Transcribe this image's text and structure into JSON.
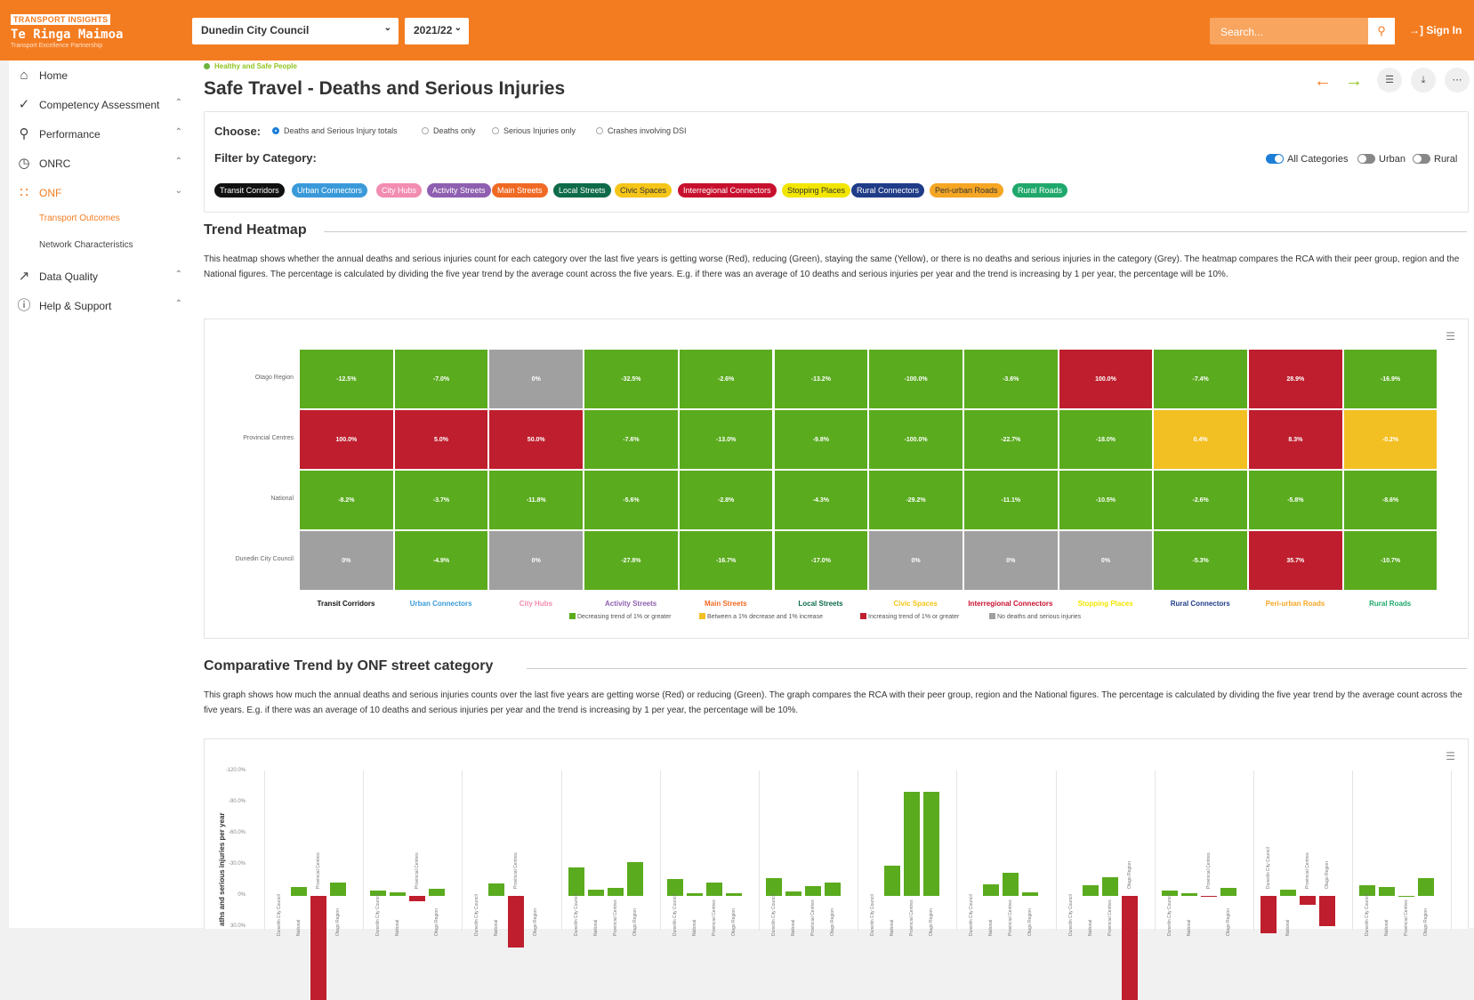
{
  "brand": {
    "tag": "TRANSPORT INSIGHTS",
    "name": "Te Ringa Maimoa",
    "sub": "Transport Excellence Partnership"
  },
  "header": {
    "council": "Dunedin City Council",
    "year": "2021/22",
    "search_placeholder": "Search...",
    "signin": "Sign In"
  },
  "sidebar": {
    "items": [
      {
        "label": "Home",
        "icon": "home-icon"
      },
      {
        "label": "Competency Assessment",
        "icon": "check-circle-icon"
      },
      {
        "label": "Performance",
        "icon": "award-icon"
      },
      {
        "label": "ONRC",
        "icon": "pie-icon"
      },
      {
        "label": "ONF",
        "icon": "grid-icon"
      },
      {
        "label": "Data Quality",
        "icon": "trend-icon"
      },
      {
        "label": "Help & Support",
        "icon": "help-icon"
      }
    ],
    "sub": [
      "Transport Outcomes",
      "Network Characteristics"
    ]
  },
  "page": {
    "crumb": "Healthy and Safe People",
    "title": "Safe Travel - Deaths and Serious Injuries"
  },
  "choose": {
    "label": "Choose:",
    "options": [
      "Deaths and Serious Injury totals",
      "Deaths only",
      "Serious Injuries only",
      "Crashes involving DSI"
    ]
  },
  "filter": {
    "label": "Filter by Category:",
    "toggles": [
      "All Categories",
      "Urban",
      "Rural"
    ]
  },
  "colors": {
    "accent": "#f47c20",
    "green": "#5aab1e",
    "red": "#be1e2d",
    "yellow": "#f3c023",
    "grey": "#a0a0a0"
  },
  "categories": [
    {
      "name": "Transit Corridors",
      "bg": "#111111",
      "fg": "#ffffff"
    },
    {
      "name": "Urban Connectors",
      "bg": "#3a9ad9",
      "fg": "#ffffff"
    },
    {
      "name": "City Hubs",
      "bg": "#f28cb1",
      "fg": "#ffffff"
    },
    {
      "name": "Activity Streets",
      "bg": "#8e5fb0",
      "fg": "#ffffff"
    },
    {
      "name": "Main Streets",
      "bg": "#f06a25",
      "fg": "#ffffff"
    },
    {
      "name": "Local Streets",
      "bg": "#0e6b4a",
      "fg": "#ffffff"
    },
    {
      "name": "Civic Spaces",
      "bg": "#f5c518",
      "fg": "#333333"
    },
    {
      "name": "Interregional Connectors",
      "bg": "#c8102e",
      "fg": "#ffffff"
    },
    {
      "name": "Stopping Places",
      "bg": "#f2e600",
      "fg": "#333333"
    },
    {
      "name": "Rural Connectors",
      "bg": "#1f3c88",
      "fg": "#ffffff"
    },
    {
      "name": "Peri-urban Roads",
      "bg": "#f5a623",
      "fg": "#333333"
    },
    {
      "name": "Rural Roads",
      "bg": "#1fa86b",
      "fg": "#ffffff"
    }
  ],
  "heatmap": {
    "title": "Trend Heatmap",
    "description": "This heatmap shows whether the annual deaths and serious injuries count for each category over the last five years is getting worse (Red), reducing (Green), staying the same (Yellow), or there is no deaths and serious injuries in the category (Grey). The heatmap compares the RCA with their peer group, region and the National figures. The percentage is calculated by dividing the five year trend by the average count across the five years. E.g. if there was an average of 10 deaths and serious injuries per year and the trend is increasing by 1 per year, the percentage will be 10%.",
    "rows": [
      "Otago Region",
      "Provincial Centres",
      "National",
      "Dunedin City Council"
    ],
    "columns": [
      "Transit Corridors",
      "Urban Connectors",
      "City Hubs",
      "Activity Streets",
      "Main Streets",
      "Local Streets",
      "Civic Spaces",
      "Interregional Connectors",
      "Stopping Places",
      "Rural Connectors",
      "Peri-urban Roads",
      "Rural Roads"
    ],
    "column_colors": [
      "#111111",
      "#3a9ad9",
      "#f28cb1",
      "#8e5fb0",
      "#f06a25",
      "#0e6b4a",
      "#f5c518",
      "#c8102e",
      "#f2e600",
      "#1f3c88",
      "#f5a623",
      "#1fa86b"
    ],
    "values": [
      [
        "-12.5%",
        "-7.0%",
        "0%",
        "-32.5%",
        "-2.6%",
        "-13.2%",
        "-100.0%",
        "-3.6%",
        "100.0%",
        "-7.4%",
        "28.9%",
        "-16.9%"
      ],
      [
        "100.0%",
        "5.0%",
        "50.0%",
        "-7.6%",
        "-13.0%",
        "-9.8%",
        "-100.0%",
        "-22.7%",
        "-18.0%",
        "0.4%",
        "8.3%",
        "-0.2%"
      ],
      [
        "-8.2%",
        "-3.7%",
        "-11.8%",
        "-5.6%",
        "-2.8%",
        "-4.3%",
        "-29.2%",
        "-11.1%",
        "-10.5%",
        "-2.6%",
        "-5.8%",
        "-8.6%"
      ],
      [
        "0%",
        "-4.9%",
        "0%",
        "-27.8%",
        "-16.7%",
        "-17.0%",
        "0%",
        "0%",
        "0%",
        "-5.3%",
        "35.7%",
        "-10.7%"
      ]
    ],
    "status": [
      [
        "g",
        "g",
        "n",
        "g",
        "g",
        "g",
        "g",
        "g",
        "r",
        "g",
        "r",
        "g"
      ],
      [
        "r",
        "r",
        "r",
        "g",
        "g",
        "g",
        "g",
        "g",
        "g",
        "y",
        "r",
        "y"
      ],
      [
        "g",
        "g",
        "g",
        "g",
        "g",
        "g",
        "g",
        "g",
        "g",
        "g",
        "g",
        "g"
      ],
      [
        "n",
        "g",
        "n",
        "g",
        "g",
        "g",
        "n",
        "n",
        "n",
        "g",
        "r",
        "g"
      ]
    ],
    "legend": [
      "Decreasing trend of 1% or greater",
      "Between a 1% decrease and 1% increase",
      "Increasing trend of 1% or greater",
      "No deaths and serious injuries"
    ]
  },
  "comparative": {
    "title": "Comparative Trend by ONF street category",
    "description": "This graph shows how much the annual deaths and serious injuries counts over the last five years are getting worse (Red) or reducing (Green). The graph compares the RCA with their peer group, region and the National figures. The percentage is calculated by dividing the five year trend by the average count across the five years. E.g. if there was an average of 10 deaths and serious injuries per year and the trend is increasing by 1 per year, the percentage will be 10%.",
    "ylabel": "aths and serious injuries per year"
  },
  "chart_data": {
    "type": "bar",
    "ylabel": "aths and serious injuries per year",
    "yticks": [
      "-120.0%",
      "-90.0%",
      "-60.0%",
      "-30.0%",
      "0%",
      "30.0%"
    ],
    "ylim": [
      -120,
      35
    ],
    "categories": [
      "Transit Corridors",
      "Urban Connectors",
      "City Hubs",
      "Activity Streets",
      "Main Streets",
      "Local Streets",
      "Civic Spaces",
      "Interregional Connectors",
      "Stopping Places",
      "Rural Connectors",
      "Peri-urban Roads",
      "Rural Roads"
    ],
    "series_order": [
      "Dunedin City Council",
      "National",
      "Provincial Centres",
      "Otago Region"
    ],
    "values": [
      [
        0,
        -8.2,
        100.0,
        -12.5
      ],
      [
        -4.9,
        -3.7,
        5.0,
        -7.0
      ],
      [
        0,
        -11.8,
        50.0,
        0
      ],
      [
        -27.8,
        -5.6,
        -7.6,
        -32.5
      ],
      [
        -16.7,
        -2.8,
        -13.0,
        -2.6
      ],
      [
        -17.0,
        -4.3,
        -9.8,
        -13.2
      ],
      [
        0,
        -29.2,
        -100.0,
        -100.0
      ],
      [
        0,
        -11.1,
        -22.7,
        -3.6
      ],
      [
        0,
        -10.5,
        -18.0,
        100.0
      ],
      [
        -5.3,
        -2.6,
        0.4,
        -7.4
      ],
      [
        35.7,
        -5.8,
        8.3,
        28.9
      ],
      [
        -10.7,
        -8.6,
        -0.2,
        -16.9
      ]
    ]
  }
}
